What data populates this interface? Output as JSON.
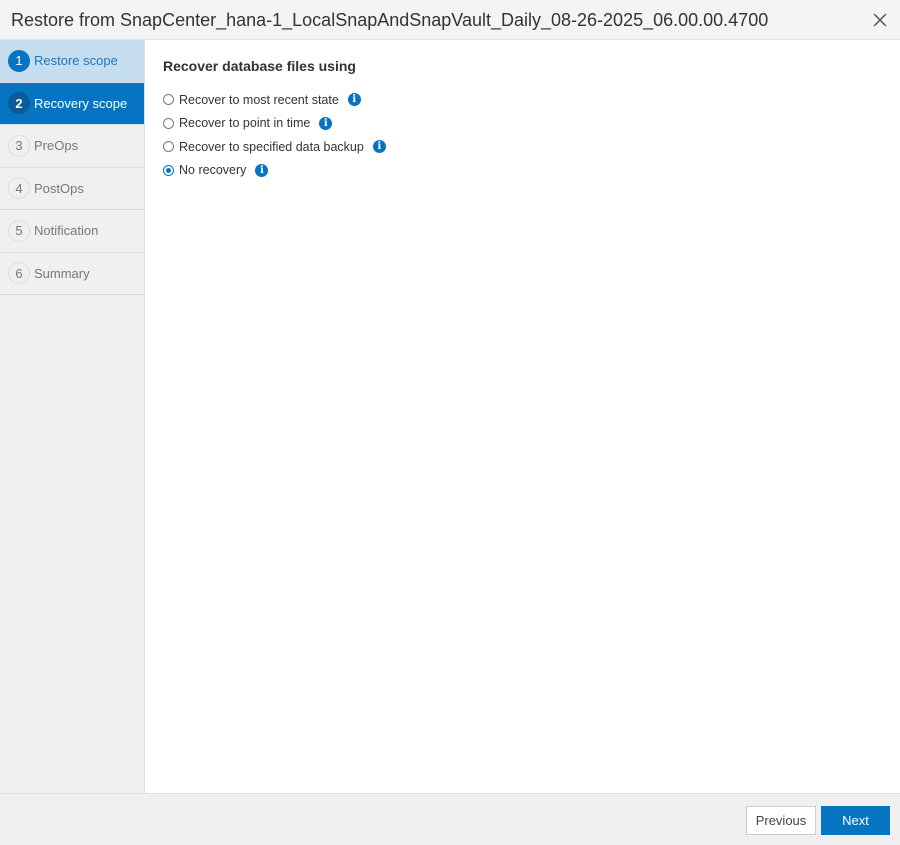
{
  "dialog": {
    "title": "Restore from SnapCenter_hana-1_LocalSnapAndSnapVault_Daily_08-26-2025_06.00.00.4700"
  },
  "steps": [
    {
      "num": "1",
      "label": "Restore scope"
    },
    {
      "num": "2",
      "label": "Recovery scope"
    },
    {
      "num": "3",
      "label": "PreOps"
    },
    {
      "num": "4",
      "label": "PostOps"
    },
    {
      "num": "5",
      "label": "Notification"
    },
    {
      "num": "6",
      "label": "Summary"
    }
  ],
  "main": {
    "heading": "Recover database files using",
    "options": [
      {
        "label": "Recover to most recent state",
        "selected": false
      },
      {
        "label": "Recover to point in time",
        "selected": false
      },
      {
        "label": "Recover to specified data backup",
        "selected": false
      },
      {
        "label": "No recovery",
        "selected": true
      }
    ],
    "info_glyph": "i"
  },
  "footer": {
    "previous": "Previous",
    "next": "Next"
  }
}
